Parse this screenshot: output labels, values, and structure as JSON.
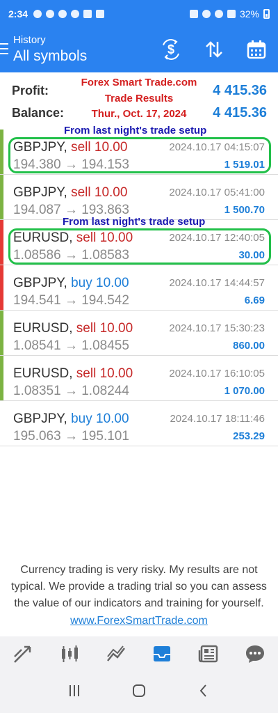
{
  "status_bar": {
    "time": "2:34",
    "battery": "32%"
  },
  "appbar": {
    "subtitle": "History",
    "title": "All symbols"
  },
  "summary": {
    "profit_label": "Profit:",
    "profit_value": "4 415.36",
    "balance_label": "Balance:",
    "balance_value": "4 415.36"
  },
  "promo": {
    "line1": "Forex Smart Trade.com",
    "line2": "Trade Results",
    "line3": "Thur., Oct. 17, 2024"
  },
  "notes": {
    "note1": "From last night's trade setup",
    "note2": "From last night's trade setup"
  },
  "trades": [
    {
      "symbol": "GBPJPY,",
      "side": "sell 10.00",
      "prices": "194.380 → 194.153",
      "time": "2024.10.17 04:15:07",
      "profit": "1 519.01",
      "bar_color": "#7cb342"
    },
    {
      "symbol": "GBPJPY,",
      "side": "sell 10.00",
      "prices": "194.087 → 193.863",
      "time": "2024.10.17 05:41:00",
      "profit": "1 500.70",
      "bar_color": "#7cb342"
    },
    {
      "symbol": "EURUSD,",
      "side": "sell 10.00",
      "prices": "1.08586 → 1.08583",
      "time": "2024.10.17 12:40:05",
      "profit": "30.00",
      "bar_color": "#e53935"
    },
    {
      "symbol": "GBPJPY,",
      "side": "buy 10.00",
      "prices": "194.541 → 194.542",
      "time": "2024.10.17 14:44:57",
      "profit": "6.69",
      "bar_color": "#e53935"
    },
    {
      "symbol": "EURUSD,",
      "side": "sell 10.00",
      "prices": "1.08541 → 1.08455",
      "time": "2024.10.17 15:30:23",
      "profit": "860.00",
      "bar_color": "#7cb342"
    },
    {
      "symbol": "EURUSD,",
      "side": "sell 10.00",
      "prices": "1.08351 → 1.08244",
      "time": "2024.10.17 16:10:05",
      "profit": "1 070.00",
      "bar_color": "#7cb342"
    },
    {
      "symbol": "GBPJPY,",
      "side": "buy 10.00",
      "prices": "195.063 → 195.101",
      "time": "2024.10.17 18:11:46",
      "profit": "253.29",
      "bar_color": "#ffffff"
    }
  ],
  "disclaimer": "Currency trading is very risky. My results are not typical. We provide a trading trial so you can assess the value of our indicators and training for yourself.",
  "website": "www.ForexSmartTrade.com",
  "bottom_nav": [
    "quotes-icon",
    "chart-icon",
    "trade-icon",
    "history-icon",
    "news-icon",
    "chat-icon"
  ],
  "colors": {
    "accent": "#2a82f0",
    "sell": "#c62828",
    "buy": "#1e7fd8",
    "highlight": "#22c04a",
    "note": "#1a1ab0"
  }
}
